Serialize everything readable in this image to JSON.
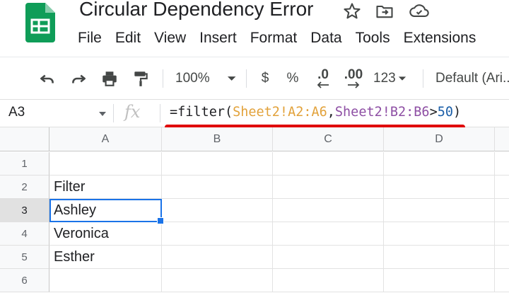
{
  "app": {
    "title": "Circular Dependency Error",
    "brand_color": "#0f9d58"
  },
  "title_icons": [
    "star-icon",
    "move-to-folder-icon",
    "cloud-status-icon"
  ],
  "menu": [
    "File",
    "Edit",
    "View",
    "Insert",
    "Format",
    "Data",
    "Tools",
    "Extensions"
  ],
  "toolbar": {
    "zoom": "100%",
    "currency": "$",
    "percent": "%",
    "decrease_decimal": ".0",
    "increase_decimal": ".00",
    "number_format": "123",
    "font": "Default (Ari..."
  },
  "formula_bar": {
    "name_box": "A3",
    "fx": "fx",
    "formula": {
      "eq": "=",
      "fn": "filter(",
      "range1": "Sheet2!A2:A6",
      "comma": ",",
      "range2": "Sheet2!B2:B6",
      "op": ">",
      "num": "50",
      "close": ")"
    },
    "colors": {
      "range1": "#e2a23b",
      "range2": "#8e4fa4",
      "number": "#1a5ea8",
      "annotation": "#e00a0a"
    }
  },
  "grid": {
    "columns": [
      "A",
      "B",
      "C",
      "D"
    ],
    "rows": [
      "1",
      "2",
      "3",
      "4",
      "5",
      "6"
    ],
    "cells_A": [
      "",
      "Filter",
      "Ashley",
      "Veronica",
      "Esther",
      ""
    ],
    "selected": "A3",
    "selection_color": "#1a73e8"
  }
}
